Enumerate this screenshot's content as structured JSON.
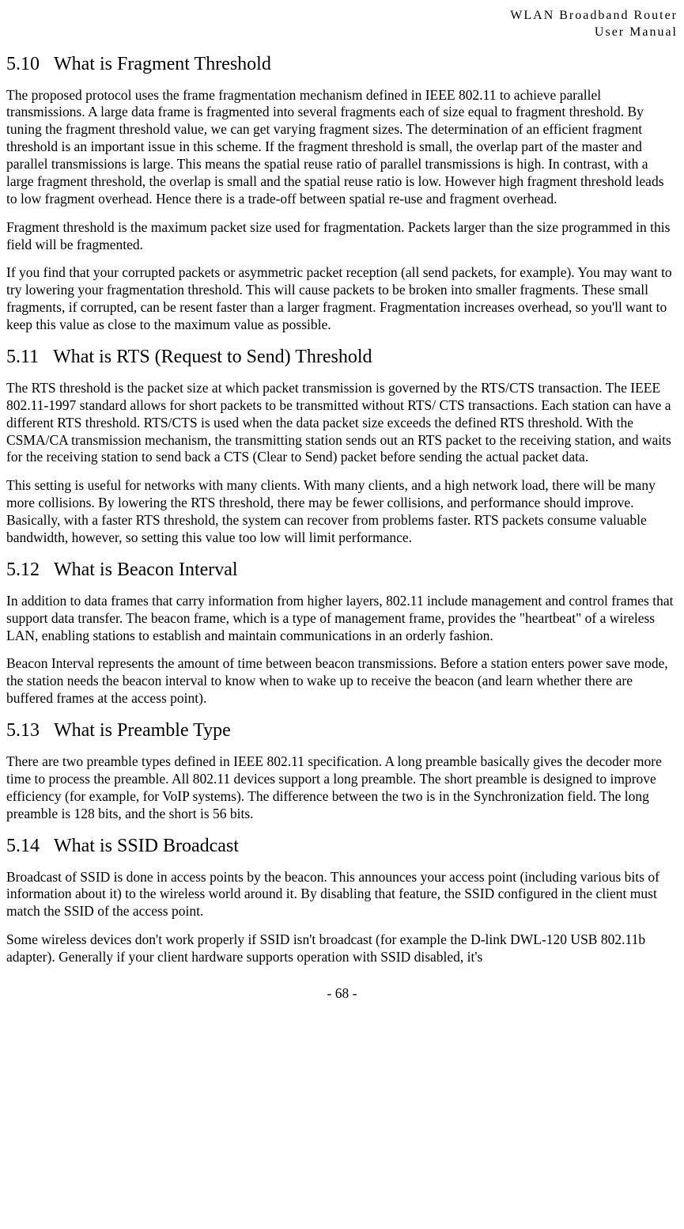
{
  "header": {
    "line1": "WLAN Broadband Router",
    "line2": "User Manual"
  },
  "sections": {
    "s510": {
      "num": "5.10",
      "title": "What is Fragment Threshold",
      "p1": "The proposed protocol uses the frame fragmentation mechanism defined in IEEE 802.11 to achieve parallel transmissions. A large data frame is fragmented into several fragments each of size equal to fragment threshold. By tuning the fragment threshold value, we can get varying fragment sizes. The determination of an efficient fragment threshold is an important issue in this scheme. If the fragment threshold is small, the overlap part of the master and parallel transmissions is large. This means the spatial reuse ratio of parallel transmissions is high. In contrast, with a large fragment threshold, the overlap is small and the spatial reuse ratio is low. However high fragment threshold leads to low fragment overhead. Hence there is a trade-off between spatial re-use and fragment overhead.",
      "p2": "Fragment threshold is the maximum packet size used for fragmentation. Packets larger than the size programmed in this field will be fragmented.",
      "p3": "If you find that your corrupted packets or asymmetric packet reception (all send packets, for example). You may want to try lowering your fragmentation threshold. This will cause packets to be broken into smaller fragments. These small fragments, if corrupted, can be resent faster than a larger fragment. Fragmentation increases overhead, so you'll want to keep this value as close to the maximum value as possible."
    },
    "s511": {
      "num": "5.11",
      "title": "What is RTS (Request to Send) Threshold",
      "p1": "The RTS threshold is the packet size at which packet transmission is governed by the RTS/CTS transaction. The IEEE 802.11-1997 standard allows for short packets to be transmitted without RTS/ CTS transactions. Each station can have a different RTS threshold. RTS/CTS is used when the data packet size exceeds the defined RTS threshold. With the CSMA/CA transmission mechanism, the transmitting station sends out an RTS packet to the receiving station, and waits for the receiving station to send back a CTS (Clear to Send) packet before sending the actual packet data.",
      "p2": "This setting is useful for networks with many clients. With many clients, and a high network load, there will be many more collisions. By lowering the RTS threshold, there may be fewer collisions, and performance should improve. Basically, with a faster RTS threshold, the system can recover  from problems faster. RTS packets consume valuable bandwidth, however, so setting this value too low will limit performance."
    },
    "s512": {
      "num": "5.12",
      "title": "What is Beacon Interval",
      "p1": "In addition to data frames that carry information from higher layers, 802.11 include management and control frames that support data transfer. The beacon frame, which is a type of management frame, provides the \"heartbeat\" of a wireless LAN, enabling stations to establish and maintain communications in an orderly fashion.",
      "p2": "Beacon Interval represents the amount of time between beacon transmissions. Before a station enters power save mode, the station needs the beacon interval to know when to wake up to receive the beacon (and learn whether there are buffered frames at the access point)."
    },
    "s513": {
      "num": "5.13",
      "title": "What is Preamble Type",
      "p1": "There are two preamble types defined in IEEE 802.11 specification. A long preamble basically gives the decoder more time to process the preamble. All 802.11 devices support a long preamble. The short preamble is designed to improve efficiency (for example, for VoIP systems). The difference between the two is in the Synchronization field. The long preamble is 128 bits, and the short is 56 bits."
    },
    "s514": {
      "num": "5.14",
      "title": "What is SSID Broadcast",
      "p1": "Broadcast of SSID is done in access points by the beacon. This announces your access point (including various bits of information about it) to the wireless world around it. By disabling that feature, the SSID configured in the client must match the SSID of the access point.",
      "p2": "Some wireless devices don't work properly if SSID isn't broadcast (for example the D-link DWL-120 USB 802.11b adapter). Generally if your client hardware supports operation with SSID disabled, it's"
    }
  },
  "footer": {
    "page": "- 68 -"
  }
}
